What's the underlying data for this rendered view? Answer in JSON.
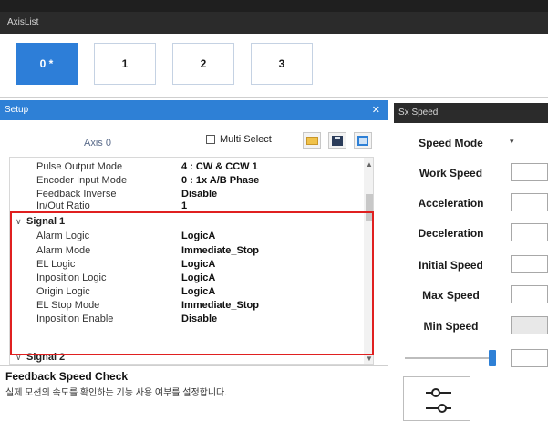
{
  "axis_list": {
    "title": "AxisList",
    "buttons": [
      "0 *",
      "1",
      "2",
      "3"
    ]
  },
  "setup": {
    "title": "Setup",
    "close_glyph": "✕",
    "axis_label": "Axis 0",
    "multi_select_label": "Multi Select",
    "rows": [
      {
        "label": "Pulse Output Mode",
        "value": "4 : CW & CCW 1"
      },
      {
        "label": "Encoder Input Mode",
        "value": "0 : 1x A/B Phase"
      },
      {
        "label": "Feedback Inverse",
        "value": "Disable"
      },
      {
        "label": "In/Out Ratio",
        "value": "1"
      },
      {
        "label": "Signal 1",
        "value": "",
        "category": true
      },
      {
        "label": "Alarm Logic",
        "value": "LogicA"
      },
      {
        "label": "Alarm Mode",
        "value": "Immediate_Stop"
      },
      {
        "label": "EL Logic",
        "value": "LogicA"
      },
      {
        "label": "Inposition Logic",
        "value": "LogicA"
      },
      {
        "label": "Origin Logic",
        "value": "LogicA"
      },
      {
        "label": "EL Stop Mode",
        "value": "Immediate_Stop"
      },
      {
        "label": "Inposition Enable",
        "value": "Disable"
      },
      {
        "label": "Signal 2",
        "value": "",
        "category": true
      }
    ],
    "description": {
      "title": "Feedback Speed Check",
      "text": "실제 모션의 속도를 확인하는 기능 사용 여부를 설정합니다."
    }
  },
  "speed": {
    "title": "Sx Speed",
    "labels": [
      "Speed Mode",
      "Work Speed",
      "Acceleration",
      "Deceleration",
      "Initial Speed",
      "Max Speed",
      "Min Speed"
    ],
    "mode_caret": "▾"
  },
  "colors": {
    "accent": "#2e80d6",
    "highlight": "#e02020",
    "panel_dark": "#2b2b2b"
  },
  "icons": [
    "folder-icon",
    "save-icon",
    "panel-icon",
    "tune-icon",
    "chevron-down-icon"
  ]
}
